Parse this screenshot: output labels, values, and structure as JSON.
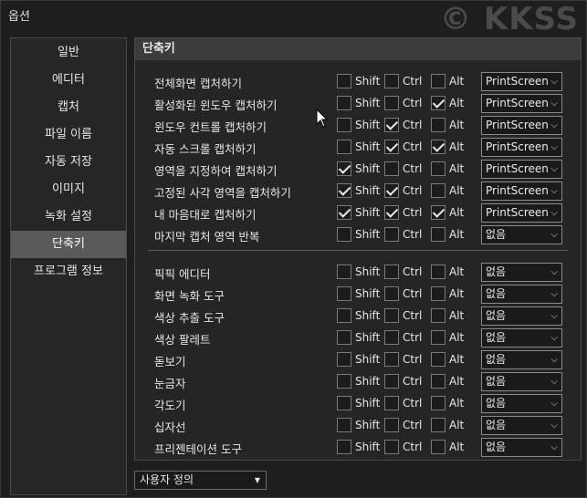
{
  "window": {
    "title": "옵션",
    "watermark": "© KKSS"
  },
  "sidebar": {
    "items": [
      {
        "label": "일반",
        "active": false
      },
      {
        "label": "에디터",
        "active": false
      },
      {
        "label": "캡처",
        "active": false
      },
      {
        "label": "파일 이름",
        "active": false
      },
      {
        "label": "자동 저장",
        "active": false
      },
      {
        "label": "이미지",
        "active": false
      },
      {
        "label": "녹화 설정",
        "active": false
      },
      {
        "label": "단축키",
        "active": true
      },
      {
        "label": "프로그램 정보",
        "active": false
      }
    ]
  },
  "panel": {
    "title": "단축키",
    "modifiers": {
      "shift": "Shift",
      "ctrl": "Ctrl",
      "alt": "Alt"
    },
    "capture_rows": [
      {
        "label": "전체화면 캡처하기",
        "shift": false,
        "ctrl": false,
        "alt": false,
        "key": "PrintScreen"
      },
      {
        "label": "활성화된 윈도우 캡처하기",
        "shift": false,
        "ctrl": false,
        "alt": true,
        "key": "PrintScreen"
      },
      {
        "label": "윈도우 컨트롤 캡처하기",
        "shift": false,
        "ctrl": true,
        "alt": false,
        "key": "PrintScreen"
      },
      {
        "label": "자동 스크롤 캡처하기",
        "shift": false,
        "ctrl": true,
        "alt": true,
        "key": "PrintScreen"
      },
      {
        "label": "영역을 지정하여 캡처하기",
        "shift": true,
        "ctrl": false,
        "alt": false,
        "key": "PrintScreen"
      },
      {
        "label": "고정된 사각 영역을 캡처하기",
        "shift": true,
        "ctrl": true,
        "alt": false,
        "key": "PrintScreen"
      },
      {
        "label": "내 마음대로 캡처하기",
        "shift": true,
        "ctrl": true,
        "alt": true,
        "key": "PrintScreen"
      },
      {
        "label": "마지막 캡처 영역 반복",
        "shift": false,
        "ctrl": false,
        "alt": false,
        "key": "없음"
      }
    ],
    "tool_rows": [
      {
        "label": "픽픽 에디터",
        "shift": false,
        "ctrl": false,
        "alt": false,
        "key": "없음"
      },
      {
        "label": "화면 녹화 도구",
        "shift": false,
        "ctrl": false,
        "alt": false,
        "key": "없음"
      },
      {
        "label": "색상 추출 도구",
        "shift": false,
        "ctrl": false,
        "alt": false,
        "key": "없음"
      },
      {
        "label": "색상 팔레트",
        "shift": false,
        "ctrl": false,
        "alt": false,
        "key": "없음"
      },
      {
        "label": "돋보기",
        "shift": false,
        "ctrl": false,
        "alt": false,
        "key": "없음"
      },
      {
        "label": "눈금자",
        "shift": false,
        "ctrl": false,
        "alt": false,
        "key": "없음"
      },
      {
        "label": "각도기",
        "shift": false,
        "ctrl": false,
        "alt": false,
        "key": "없음"
      },
      {
        "label": "십자선",
        "shift": false,
        "ctrl": false,
        "alt": false,
        "key": "없음"
      },
      {
        "label": "프리젠테이션 도구",
        "shift": false,
        "ctrl": false,
        "alt": false,
        "key": "없음"
      }
    ]
  },
  "preset": {
    "value": "사용자 정의"
  },
  "icons": {
    "dropdown": "chevron-down-icon",
    "cursor": "mouse-pointer-icon"
  }
}
